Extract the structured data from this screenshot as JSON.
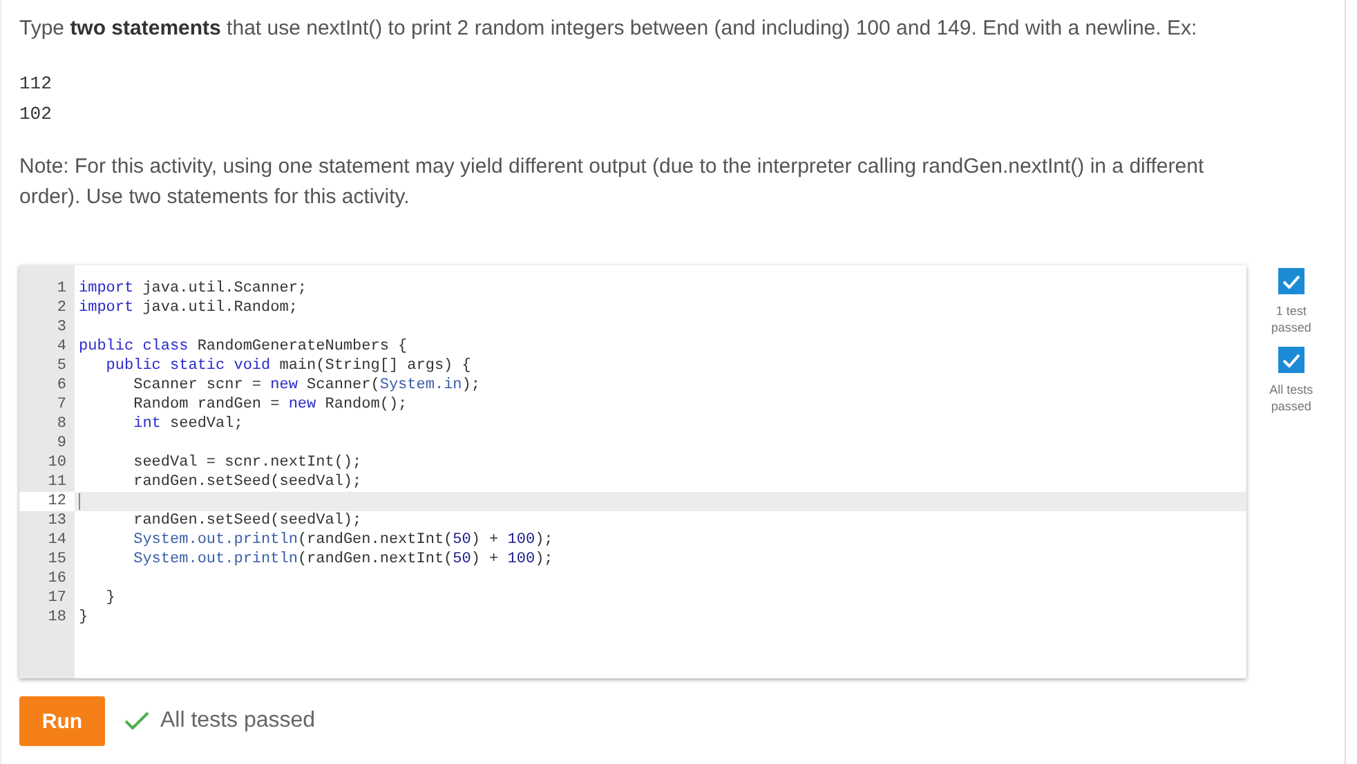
{
  "prompt": "Type **two statements** that use nextInt() to print 2 random integers between (and including) 100 and 149. End with a newline. Ex:",
  "example_output": [
    "112",
    "102"
  ],
  "note": "Note: For this activity, using one statement may yield different output (due to the interpreter calling randGen.nextInt() in a different order). Use two statements for this activity.",
  "code_lines": [
    {
      "number": "1",
      "current": false,
      "tokens": [
        {
          "kind": "kw",
          "text": "import"
        },
        {
          "kind": "text",
          "text": " java.util.Scanner;"
        }
      ]
    },
    {
      "number": "2",
      "current": false,
      "tokens": [
        {
          "kind": "kw",
          "text": "import"
        },
        {
          "kind": "text",
          "text": " java.util.Random;"
        }
      ]
    },
    {
      "number": "3",
      "current": false
    },
    {
      "number": "4",
      "current": false,
      "tokens": [
        {
          "kind": "kw",
          "text": "public class"
        },
        {
          "kind": "text",
          "text": " RandomGenerateNumbers {"
        }
      ]
    },
    {
      "number": "5",
      "current": false,
      "tokens": [
        {
          "kind": "kw",
          "text": "   public static void"
        },
        {
          "kind": "text",
          "text": " main(String[] args) {"
        }
      ]
    },
    {
      "number": "6",
      "current": false,
      "tokens": [
        {
          "kind": "text",
          "text": "      Scanner scnr = "
        },
        {
          "kind": "kw",
          "text": "new"
        },
        {
          "kind": "text",
          "text": " Scanner("
        },
        {
          "kind": "var",
          "text": "System.in"
        },
        {
          "kind": "text",
          "text": ");"
        }
      ]
    },
    {
      "number": "7",
      "current": false,
      "tokens": [
        {
          "kind": "text",
          "text": "      Random randGen = "
        },
        {
          "kind": "kw",
          "text": "new"
        },
        {
          "kind": "text",
          "text": " Random();"
        }
      ]
    },
    {
      "number": "8",
      "current": false,
      "tokens": [
        {
          "kind": "kw",
          "text": "      int"
        },
        {
          "kind": "text",
          "text": " seedVal;"
        }
      ]
    },
    {
      "number": "9",
      "current": false
    },
    {
      "number": "10",
      "current": false,
      "tokens": [
        {
          "kind": "text",
          "text": "      seedVal = scnr.nextInt();"
        }
      ]
    },
    {
      "number": "11",
      "current": false,
      "tokens": [
        {
          "kind": "text",
          "text": "      randGen.setSeed(seedVal);"
        }
      ]
    },
    {
      "number": "12",
      "current": true
    },
    {
      "number": "13",
      "current": false,
      "tokens": [
        {
          "kind": "text",
          "text": "      randGen.setSeed(seedVal);"
        }
      ]
    },
    {
      "number": "14",
      "current": false,
      "tokens": [
        {
          "kind": "var",
          "text": "      System.out.println"
        },
        {
          "kind": "text",
          "text": "(randGen.nextInt("
        },
        {
          "kind": "num",
          "text": "50"
        },
        {
          "kind": "text",
          "text": ") + "
        },
        {
          "kind": "num",
          "text": "100"
        },
        {
          "kind": "text",
          "text": ");"
        }
      ]
    },
    {
      "number": "15",
      "current": false,
      "tokens": [
        {
          "kind": "var",
          "text": "      System.out.println"
        },
        {
          "kind": "text",
          "text": "(randGen.nextInt("
        },
        {
          "kind": "num",
          "text": "50"
        },
        {
          "kind": "text",
          "text": ") + "
        },
        {
          "kind": "num",
          "text": "100"
        },
        {
          "kind": "text",
          "text": ");"
        }
      ]
    },
    {
      "number": "16",
      "current": false
    },
    {
      "number": "17",
      "current": false,
      "tokens": [
        {
          "kind": "text",
          "text": "   }"
        }
      ]
    },
    {
      "number": "18",
      "current": false,
      "tokens": [
        {
          "kind": "text",
          "text": "}"
        }
      ]
    }
  ],
  "tests": [
    {
      "label": "1 test passed",
      "checked": true
    },
    {
      "label": "All tests passed",
      "checked": true
    }
  ],
  "run_button": "Run",
  "result": {
    "passed": true,
    "message": "All tests passed"
  }
}
